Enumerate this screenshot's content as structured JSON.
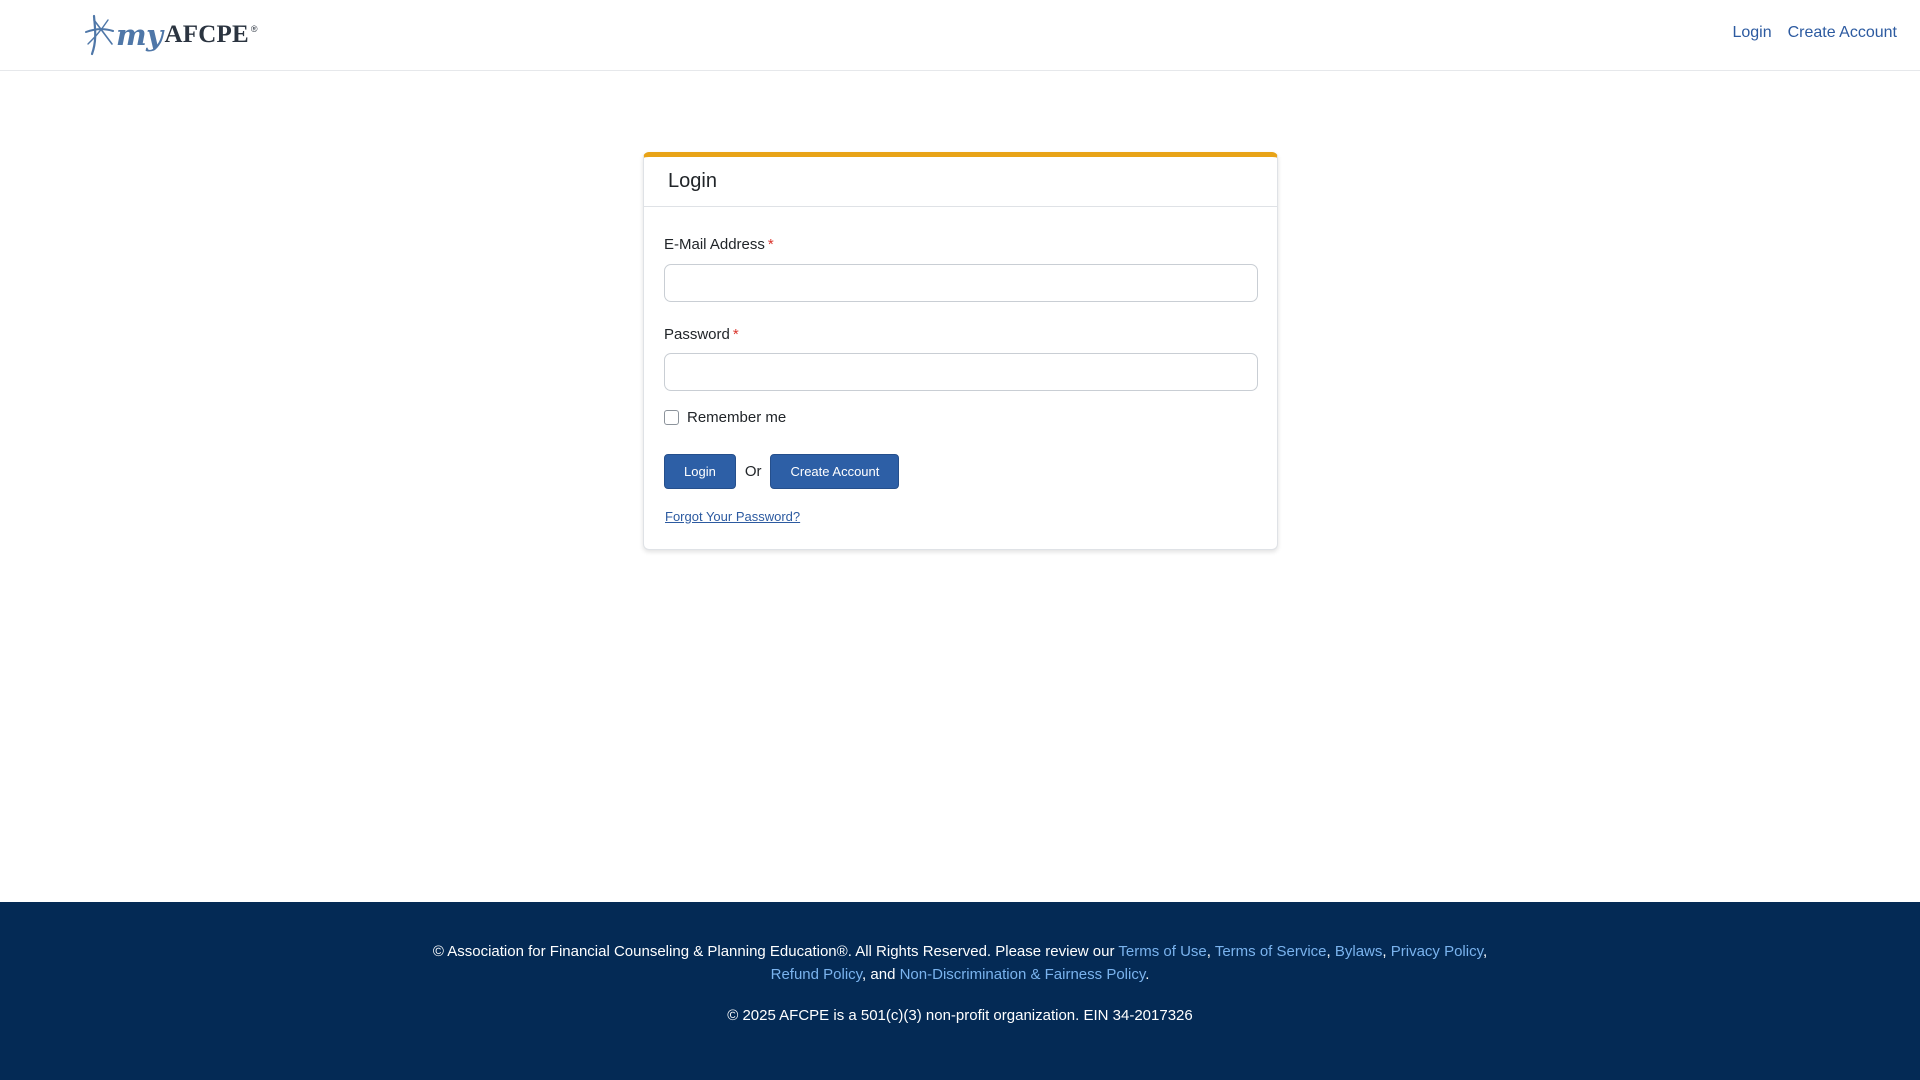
{
  "header": {
    "logo": {
      "my": "my",
      "brand": "AFCPE",
      "reg": "®",
      "icon": "compass-star-icon",
      "color_my": "#4f77a8",
      "color_brand": "#2b3440"
    },
    "nav": {
      "login": "Login",
      "create_account": "Create Account"
    }
  },
  "login_card": {
    "title": "Login",
    "accent_color": "#e8a317",
    "email": {
      "label": "E-Mail Address",
      "required_marker": "*",
      "value": "",
      "placeholder": ""
    },
    "password": {
      "label": "Password",
      "required_marker": "*",
      "value": "",
      "placeholder": ""
    },
    "remember_me": {
      "label": "Remember me",
      "checked": false
    },
    "login_button": "Login",
    "or_text": "Or",
    "create_account_button": "Create Account",
    "forgot_password": "Forgot Your Password?",
    "button_color": "#2d5fa6"
  },
  "footer": {
    "background": "#042a55",
    "copyright_prefix": "© Association for Financial Counseling & Planning Education®. All Rights Reserved. Please review our",
    "links": {
      "terms_of_use": "Terms of Use",
      "terms_of_service": "Terms of Service",
      "bylaws": "Bylaws",
      "privacy_policy": "Privacy Policy",
      "refund_policy": "Refund Policy",
      "non_discrimination": "Non-Discrimination & Fairness Policy"
    },
    "sep_comma": ",",
    "sep_and": ", and",
    "sep_period": ".",
    "nonprofit": "© 2025 AFCPE is a 501(c)(3) non-profit organization. EIN 34-2017326"
  }
}
